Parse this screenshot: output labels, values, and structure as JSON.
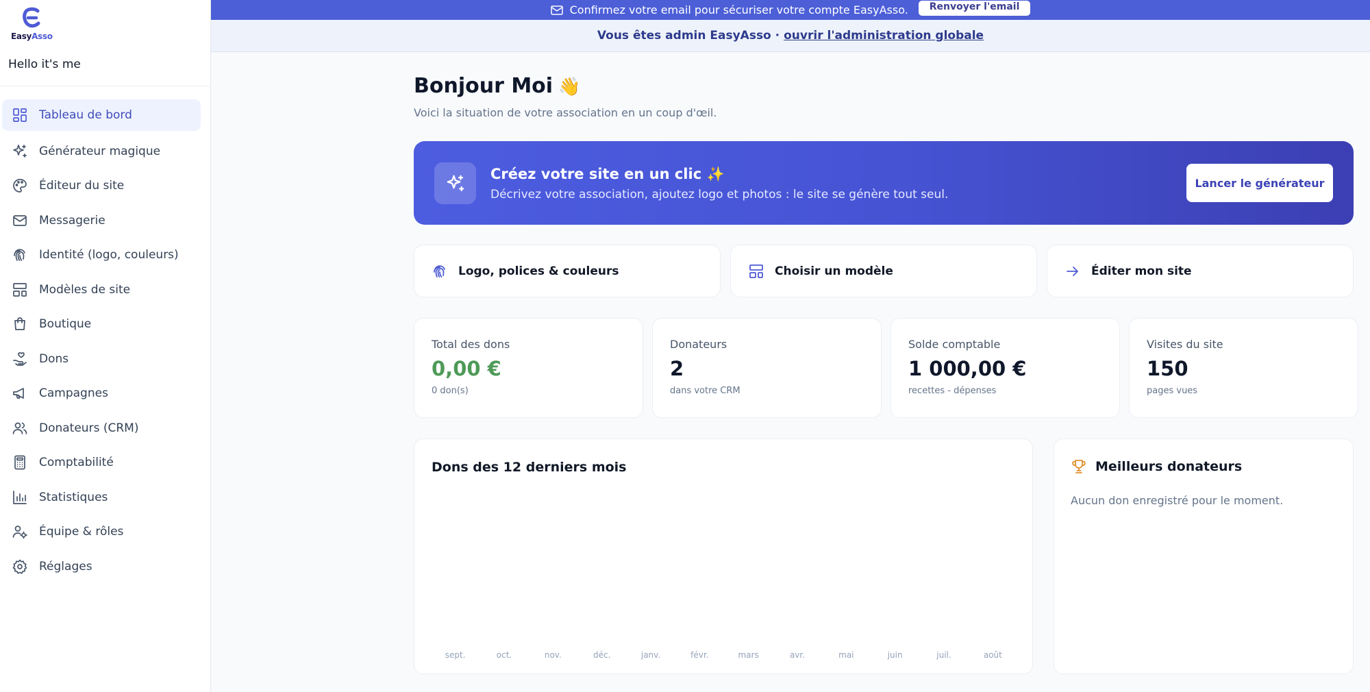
{
  "brand": {
    "name_part1": "Easy",
    "name_part2": "Asso",
    "accent": "#4f5bd5"
  },
  "sidebar": {
    "user": "Hello it's me",
    "items": [
      {
        "label": "Tableau de bord",
        "icon": "dashboard-icon",
        "active": true
      },
      {
        "label": "Générateur magique",
        "icon": "sparkles-icon"
      },
      {
        "label": "Éditeur du site",
        "icon": "palette-icon"
      },
      {
        "label": "Messagerie",
        "icon": "mail-icon"
      },
      {
        "label": "Identité (logo, couleurs)",
        "icon": "fingerprint-icon"
      },
      {
        "label": "Modèles de site",
        "icon": "layout-icon"
      },
      {
        "label": "Boutique",
        "icon": "shopping-bag-icon"
      },
      {
        "label": "Dons",
        "icon": "hand-heart-icon"
      },
      {
        "label": "Campagnes",
        "icon": "megaphone-icon"
      },
      {
        "label": "Donateurs (CRM)",
        "icon": "users-icon"
      },
      {
        "label": "Comptabilité",
        "icon": "calculator-icon"
      },
      {
        "label": "Statistiques",
        "icon": "bar-chart-icon"
      },
      {
        "label": "Équipe & rôles",
        "icon": "user-cog-icon"
      },
      {
        "label": "Réglages",
        "icon": "gear-icon"
      }
    ]
  },
  "email_banner": {
    "text": "Confirmez votre email pour sécuriser votre compte EasyAsso.",
    "button": "Renvoyer l'email",
    "color": "#4c5fd7"
  },
  "admin_banner": {
    "text": "Vous êtes admin EasyAsso ·",
    "link": "ouvrir l'administration globale"
  },
  "greeting": {
    "title": "Bonjour Moi",
    "emoji": "👋",
    "subtitle": "Voici la situation de votre association en un coup d'œil."
  },
  "hero": {
    "title": "Créez votre site en un clic ✨",
    "description": "Décrivez votre association, ajoutez logo et photos : le site se génère tout seul.",
    "button": "Lancer le générateur"
  },
  "quick_actions": [
    {
      "label": "Logo, polices & couleurs",
      "icon": "fingerprint-icon"
    },
    {
      "label": "Choisir un modèle",
      "icon": "layout-icon"
    },
    {
      "label": "Éditer mon site",
      "icon": "arrow-right-icon"
    }
  ],
  "stats": [
    {
      "label": "Total des dons",
      "value": "0,00 €",
      "note": "0 don(s)",
      "color": "#4e9a58"
    },
    {
      "label": "Donateurs",
      "value": "2",
      "note": "dans votre CRM"
    },
    {
      "label": "Solde comptable",
      "value": "1 000,00 €",
      "note": "recettes - dépenses"
    },
    {
      "label": "Visites du site",
      "value": "150",
      "note": "pages vues"
    }
  ],
  "chart_data": {
    "type": "bar",
    "title": "Dons des 12 derniers mois",
    "categories": [
      "sept.",
      "oct.",
      "nov.",
      "déc.",
      "janv.",
      "févr.",
      "mars",
      "avr.",
      "mai",
      "juin",
      "juil.",
      "août"
    ],
    "values": [
      0,
      0,
      0,
      0,
      0,
      0,
      0,
      0,
      0,
      0,
      0,
      0
    ],
    "grid": false,
    "legend": "none"
  },
  "top_donors": {
    "title": "Meilleurs donateurs",
    "icon": "trophy-icon",
    "empty": "Aucun don enregistré pour le moment."
  }
}
